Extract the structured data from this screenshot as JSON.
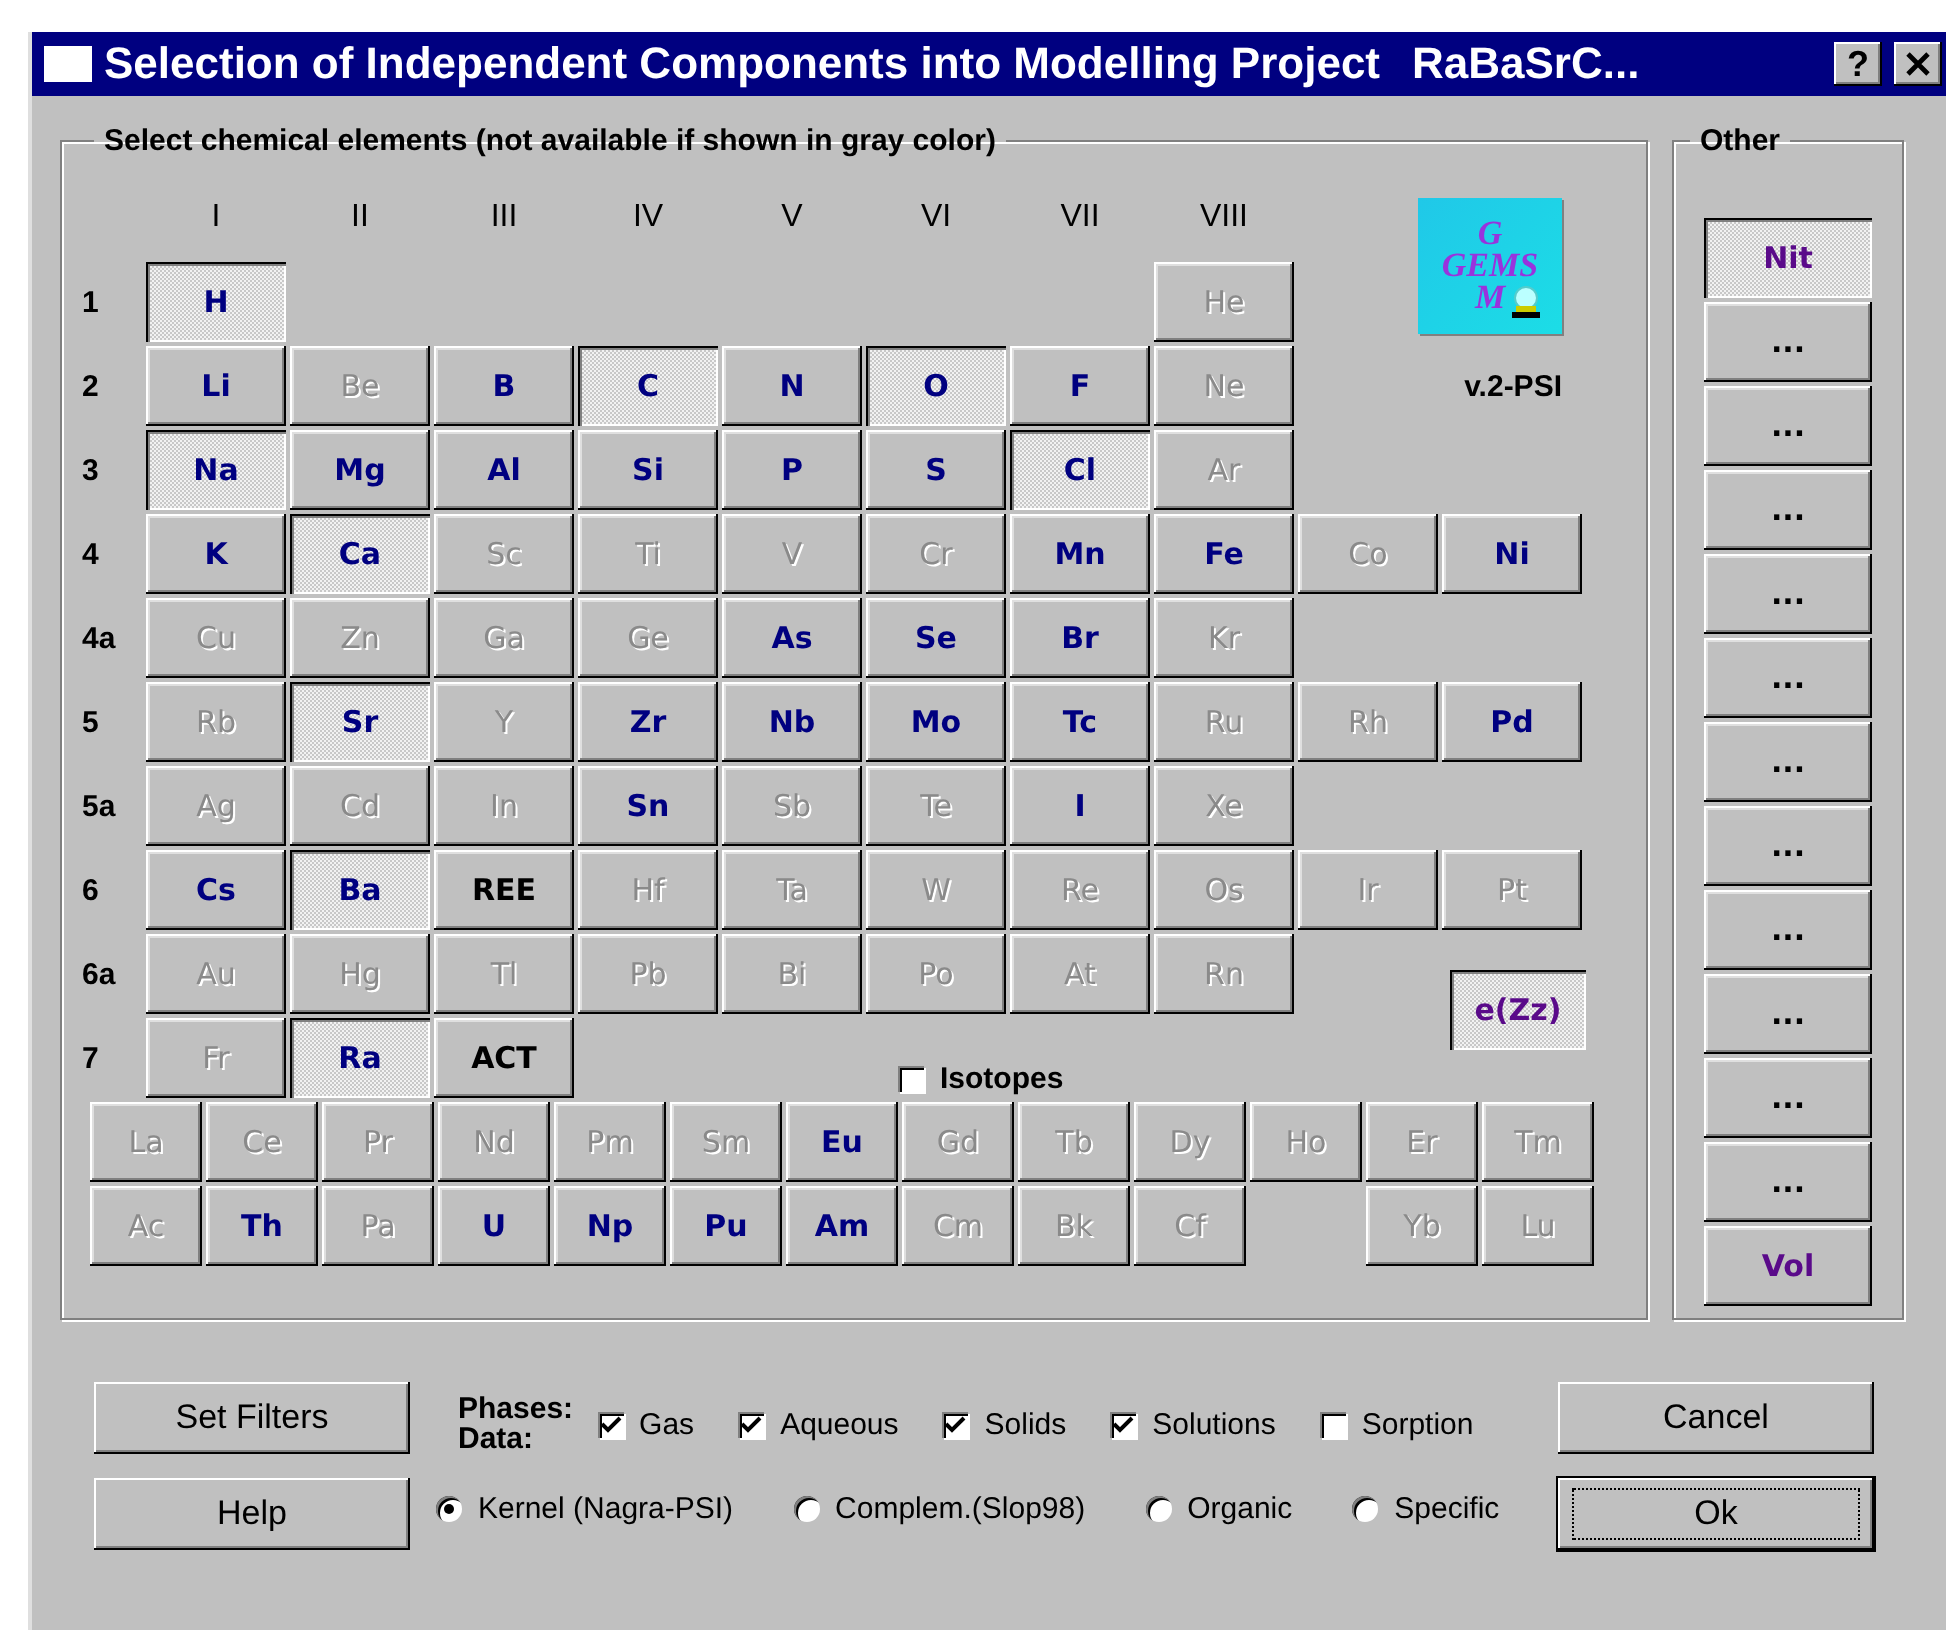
{
  "window": {
    "title": "Selection of Independent Components into Modelling Project",
    "project": "RaBaSrC...",
    "help_button": "?"
  },
  "elements_group": {
    "title": "Select chemical elements (not available if shown in gray color)",
    "column_headers": [
      "I",
      "II",
      "III",
      "IV",
      "V",
      "VI",
      "VII",
      "VIII"
    ],
    "rows": [
      {
        "label": "1",
        "cells": [
          {
            "symbol": "H",
            "kind": "element",
            "available": true,
            "selected": true
          },
          {
            "kind": "gap"
          },
          {
            "kind": "gap"
          },
          {
            "kind": "gap"
          },
          {
            "kind": "gap"
          },
          {
            "kind": "gap"
          },
          {
            "kind": "gap"
          },
          {
            "symbol": "He",
            "kind": "element",
            "available": false,
            "selected": false
          }
        ]
      },
      {
        "label": "2",
        "cells": [
          {
            "symbol": "Li",
            "kind": "element",
            "available": true,
            "selected": false
          },
          {
            "symbol": "Be",
            "kind": "element",
            "available": false,
            "selected": false
          },
          {
            "symbol": "B",
            "kind": "element",
            "available": true,
            "selected": false
          },
          {
            "symbol": "C",
            "kind": "element",
            "available": true,
            "selected": true
          },
          {
            "symbol": "N",
            "kind": "element",
            "available": true,
            "selected": false
          },
          {
            "symbol": "O",
            "kind": "element",
            "available": true,
            "selected": true
          },
          {
            "symbol": "F",
            "kind": "element",
            "available": true,
            "selected": false
          },
          {
            "symbol": "Ne",
            "kind": "element",
            "available": false,
            "selected": false
          }
        ]
      },
      {
        "label": "3",
        "cells": [
          {
            "symbol": "Na",
            "kind": "element",
            "available": true,
            "selected": true
          },
          {
            "symbol": "Mg",
            "kind": "element",
            "available": true,
            "selected": false
          },
          {
            "symbol": "Al",
            "kind": "element",
            "available": true,
            "selected": false
          },
          {
            "symbol": "Si",
            "kind": "element",
            "available": true,
            "selected": false
          },
          {
            "symbol": "P",
            "kind": "element",
            "available": true,
            "selected": false
          },
          {
            "symbol": "S",
            "kind": "element",
            "available": true,
            "selected": false
          },
          {
            "symbol": "Cl",
            "kind": "element",
            "available": true,
            "selected": true
          },
          {
            "symbol": "Ar",
            "kind": "element",
            "available": false,
            "selected": false
          }
        ]
      },
      {
        "label": "4",
        "cells": [
          {
            "symbol": "K",
            "kind": "element",
            "available": true,
            "selected": false
          },
          {
            "symbol": "Ca",
            "kind": "element",
            "available": true,
            "selected": true
          },
          {
            "symbol": "Sc",
            "kind": "element",
            "available": false,
            "selected": false
          },
          {
            "symbol": "Ti",
            "kind": "element",
            "available": false,
            "selected": false
          },
          {
            "symbol": "V",
            "kind": "element",
            "available": false,
            "selected": false
          },
          {
            "symbol": "Cr",
            "kind": "element",
            "available": false,
            "selected": false
          },
          {
            "symbol": "Mn",
            "kind": "element",
            "available": true,
            "selected": false
          },
          {
            "symbol": "Fe",
            "kind": "element",
            "available": true,
            "selected": false
          },
          {
            "symbol": "Co",
            "kind": "element",
            "available": false,
            "selected": false
          },
          {
            "symbol": "Ni",
            "kind": "element",
            "available": true,
            "selected": false
          }
        ]
      },
      {
        "label": "4a",
        "cells": [
          {
            "symbol": "Cu",
            "kind": "element",
            "available": false,
            "selected": false
          },
          {
            "symbol": "Zn",
            "kind": "element",
            "available": false,
            "selected": false
          },
          {
            "symbol": "Ga",
            "kind": "element",
            "available": false,
            "selected": false
          },
          {
            "symbol": "Ge",
            "kind": "element",
            "available": false,
            "selected": false
          },
          {
            "symbol": "As",
            "kind": "element",
            "available": true,
            "selected": false
          },
          {
            "symbol": "Se",
            "kind": "element",
            "available": true,
            "selected": false
          },
          {
            "symbol": "Br",
            "kind": "element",
            "available": true,
            "selected": false
          },
          {
            "symbol": "Kr",
            "kind": "element",
            "available": false,
            "selected": false
          }
        ]
      },
      {
        "label": "5",
        "cells": [
          {
            "symbol": "Rb",
            "kind": "element",
            "available": false,
            "selected": false
          },
          {
            "symbol": "Sr",
            "kind": "element",
            "available": true,
            "selected": true
          },
          {
            "symbol": "Y",
            "kind": "element",
            "available": false,
            "selected": false
          },
          {
            "symbol": "Zr",
            "kind": "element",
            "available": true,
            "selected": false
          },
          {
            "symbol": "Nb",
            "kind": "element",
            "available": true,
            "selected": false
          },
          {
            "symbol": "Mo",
            "kind": "element",
            "available": true,
            "selected": false
          },
          {
            "symbol": "Tc",
            "kind": "element",
            "available": true,
            "selected": false
          },
          {
            "symbol": "Ru",
            "kind": "element",
            "available": false,
            "selected": false
          },
          {
            "symbol": "Rh",
            "kind": "element",
            "available": false,
            "selected": false
          },
          {
            "symbol": "Pd",
            "kind": "element",
            "available": true,
            "selected": false
          }
        ]
      },
      {
        "label": "5a",
        "cells": [
          {
            "symbol": "Ag",
            "kind": "element",
            "available": false,
            "selected": false
          },
          {
            "symbol": "Cd",
            "kind": "element",
            "available": false,
            "selected": false
          },
          {
            "symbol": "In",
            "kind": "element",
            "available": false,
            "selected": false
          },
          {
            "symbol": "Sn",
            "kind": "element",
            "available": true,
            "selected": false
          },
          {
            "symbol": "Sb",
            "kind": "element",
            "available": false,
            "selected": false
          },
          {
            "symbol": "Te",
            "kind": "element",
            "available": false,
            "selected": false
          },
          {
            "symbol": "I",
            "kind": "element",
            "available": true,
            "selected": false
          },
          {
            "symbol": "Xe",
            "kind": "element",
            "available": false,
            "selected": false
          }
        ]
      },
      {
        "label": "6",
        "cells": [
          {
            "symbol": "Cs",
            "kind": "element",
            "available": true,
            "selected": false
          },
          {
            "symbol": "Ba",
            "kind": "element",
            "available": true,
            "selected": true
          },
          {
            "symbol": "REE",
            "kind": "group",
            "available": true,
            "selected": false
          },
          {
            "symbol": "Hf",
            "kind": "element",
            "available": false,
            "selected": false
          },
          {
            "symbol": "Ta",
            "kind": "element",
            "available": false,
            "selected": false
          },
          {
            "symbol": "W",
            "kind": "element",
            "available": false,
            "selected": false
          },
          {
            "symbol": "Re",
            "kind": "element",
            "available": false,
            "selected": false
          },
          {
            "symbol": "Os",
            "kind": "element",
            "available": false,
            "selected": false
          },
          {
            "symbol": "Ir",
            "kind": "element",
            "available": false,
            "selected": false
          },
          {
            "symbol": "Pt",
            "kind": "element",
            "available": false,
            "selected": false
          }
        ]
      },
      {
        "label": "6a",
        "cells": [
          {
            "symbol": "Au",
            "kind": "element",
            "available": false,
            "selected": false
          },
          {
            "symbol": "Hg",
            "kind": "element",
            "available": false,
            "selected": false
          },
          {
            "symbol": "Tl",
            "kind": "element",
            "available": false,
            "selected": false
          },
          {
            "symbol": "Pb",
            "kind": "element",
            "available": false,
            "selected": false
          },
          {
            "symbol": "Bi",
            "kind": "element",
            "available": false,
            "selected": false
          },
          {
            "symbol": "Po",
            "kind": "element",
            "available": false,
            "selected": false
          },
          {
            "symbol": "At",
            "kind": "element",
            "available": false,
            "selected": false
          },
          {
            "symbol": "Rn",
            "kind": "element",
            "available": false,
            "selected": false
          }
        ]
      },
      {
        "label": "7",
        "cells": [
          {
            "symbol": "Fr",
            "kind": "element",
            "available": false,
            "selected": false
          },
          {
            "symbol": "Ra",
            "kind": "element",
            "available": true,
            "selected": true
          },
          {
            "symbol": "ACT",
            "kind": "group",
            "available": true,
            "selected": false
          }
        ]
      }
    ],
    "logo_text": [
      "G",
      "GEMS",
      "M"
    ],
    "version": "v.2-PSI",
    "electron": {
      "symbol": "e(Zz)",
      "selected": true
    },
    "isotopes": {
      "label": "Isotopes",
      "checked": false
    },
    "lanthanides": [
      {
        "symbol": "La",
        "available": false
      },
      {
        "symbol": "Ce",
        "available": false
      },
      {
        "symbol": "Pr",
        "available": false
      },
      {
        "symbol": "Nd",
        "available": false
      },
      {
        "symbol": "Pm",
        "available": false
      },
      {
        "symbol": "Sm",
        "available": false
      },
      {
        "symbol": "Eu",
        "available": true
      },
      {
        "symbol": "Gd",
        "available": false
      },
      {
        "symbol": "Tb",
        "available": false
      },
      {
        "symbol": "Dy",
        "available": false
      },
      {
        "symbol": "Ho",
        "available": false
      },
      {
        "symbol": "Er",
        "available": false
      },
      {
        "symbol": "Tm",
        "available": false
      }
    ],
    "actinides": [
      {
        "symbol": "Ac",
        "available": false
      },
      {
        "symbol": "Th",
        "available": true
      },
      {
        "symbol": "Pa",
        "available": false
      },
      {
        "symbol": "U",
        "available": true
      },
      {
        "symbol": "Np",
        "available": true
      },
      {
        "symbol": "Pu",
        "available": true
      },
      {
        "symbol": "Am",
        "available": true
      },
      {
        "symbol": "Cm",
        "available": false
      },
      {
        "symbol": "Bk",
        "available": false
      },
      {
        "symbol": "Cf",
        "available": false
      },
      {
        "kind": "gap"
      },
      {
        "symbol": "Yb",
        "available": false
      },
      {
        "symbol": "Lu",
        "available": false
      }
    ]
  },
  "other_group": {
    "title": "Other",
    "buttons": [
      {
        "label": "Nit",
        "defined": true,
        "selected": true
      },
      {
        "label": "...",
        "defined": false,
        "selected": false
      },
      {
        "label": "...",
        "defined": false,
        "selected": false
      },
      {
        "label": "...",
        "defined": false,
        "selected": false
      },
      {
        "label": "...",
        "defined": false,
        "selected": false
      },
      {
        "label": "...",
        "defined": false,
        "selected": false
      },
      {
        "label": "...",
        "defined": false,
        "selected": false
      },
      {
        "label": "...",
        "defined": false,
        "selected": false
      },
      {
        "label": "...",
        "defined": false,
        "selected": false
      },
      {
        "label": "...",
        "defined": false,
        "selected": false
      },
      {
        "label": "...",
        "defined": false,
        "selected": false
      },
      {
        "label": "...",
        "defined": false,
        "selected": false
      },
      {
        "label": "Vol",
        "defined": true,
        "selected": false
      }
    ]
  },
  "set_filters_button": "Set Filters",
  "help_button": "Help",
  "phases_label": "Phases:",
  "data_label": "Data:",
  "phases": [
    {
      "label": "Gas",
      "checked": true
    },
    {
      "label": "Aqueous",
      "checked": true
    },
    {
      "label": "Solids",
      "checked": true
    },
    {
      "label": "Solutions",
      "checked": true
    },
    {
      "label": "Sorption",
      "checked": false
    }
  ],
  "data_sources": [
    {
      "label": "Kernel (Nagra-PSI)",
      "selected": true
    },
    {
      "label": "Complem.(Slop98)",
      "selected": false
    },
    {
      "label": "Organic",
      "selected": false
    },
    {
      "label": "Specific",
      "selected": false
    }
  ],
  "cancel_button": "Cancel",
  "ok_button": "Ok"
}
